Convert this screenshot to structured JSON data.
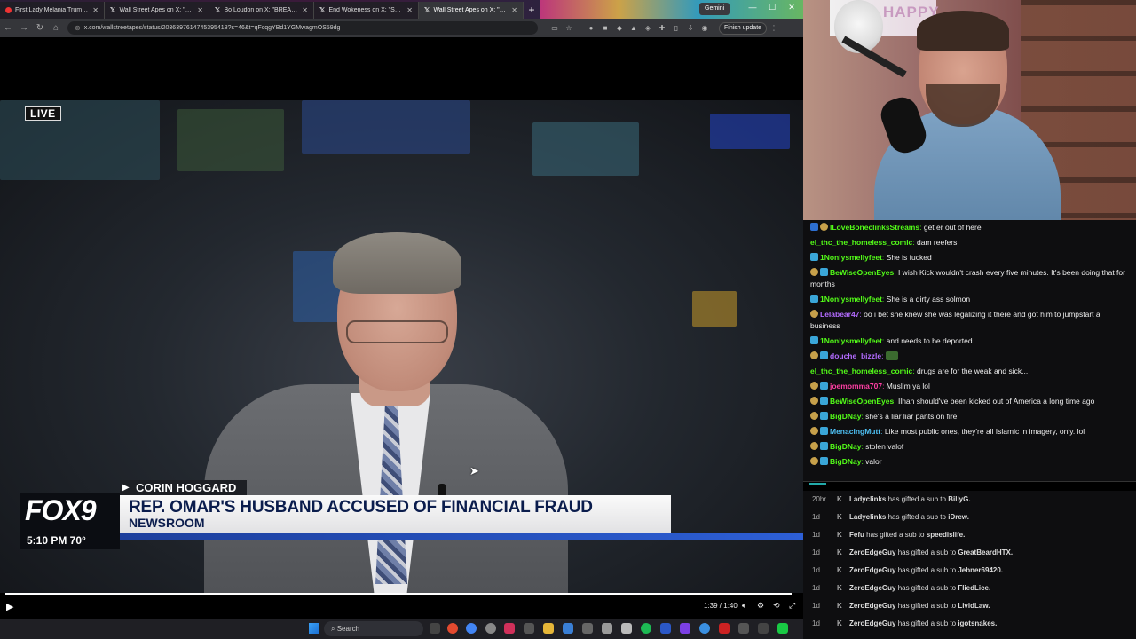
{
  "browser": {
    "tabs": [
      {
        "label": "First Lady Melania Trump Ope…",
        "favicon": "red-dot-icon",
        "active": false
      },
      {
        "label": "Wall Street Apes on X: \"Minne…",
        "favicon": "x-logo-icon",
        "active": false
      },
      {
        "label": "Bo Loudon on X: \"BREA…",
        "favicon": "x-logo-icon",
        "active": false
      },
      {
        "label": "End Wokeness on X: \"Senat…",
        "favicon": "x-logo-icon",
        "active": false
      },
      {
        "label": "Wall Street Apes on X: \"M…",
        "favicon": "x-logo-icon",
        "active": true
      }
    ],
    "new_tab": "+",
    "gemini_label": "Gemini",
    "url": "x.com/wallstreetapes/status/2036397614745395418?s=46&t=qFcqgYBd1YGMwagmOS59dg",
    "finish_update_label": "Finish update"
  },
  "video": {
    "live_label": "LIVE",
    "reporter": "CORIN HOGGARD",
    "headline": "REP. OMAR'S HUSBAND ACCUSED OF FINANCIAL FRAUD",
    "subhead": "NEWSROOM",
    "station_logo": "FOX9",
    "station_time": "5:10 PM   70°",
    "time_display": "1:39 / 1:40",
    "progress": 0.99
  },
  "webcam": {
    "poster_text": "HAPPY"
  },
  "chat": [
    {
      "user": "ILoveBoneclinksStreams",
      "color": "u-green",
      "badges": [
        "tblue",
        "gold"
      ],
      "text": "get er out of here"
    },
    {
      "user": "el_thc_the_homeless_comic",
      "color": "u-green",
      "badges": [],
      "text": "dam reefers"
    },
    {
      "user": "1Nonlysmellyfeet",
      "color": "u-green",
      "badges": [
        "blue"
      ],
      "text": "She is fucked"
    },
    {
      "user": "BeWiseOpenEyes",
      "color": "u-green",
      "badges": [
        "gold",
        "blue"
      ],
      "text": "I wish Kick wouldn't crash every five minutes. It's been doing that for months"
    },
    {
      "user": "1Nonlysmellyfeet",
      "color": "u-green",
      "badges": [
        "blue"
      ],
      "text": "She is a dirty ass solmon"
    },
    {
      "user": "Lelabear47",
      "color": "u-purple",
      "badges": [
        "gold"
      ],
      "text": "oo i bet she knew she was legalizing it there and got him to jumpstart a business"
    },
    {
      "user": "1Nonlysmellyfeet",
      "color": "u-green",
      "badges": [
        "blue"
      ],
      "text": "and needs to be deported"
    },
    {
      "user": "douche_bizzle",
      "color": "u-purple",
      "badges": [
        "gold",
        "blue"
      ],
      "text": "",
      "emote": "pepe-emote"
    },
    {
      "user": "el_thc_the_homeless_comic",
      "color": "u-green",
      "badges": [],
      "text": "drugs are for the weak and sick..."
    },
    {
      "user": "joemomma707",
      "color": "u-pink",
      "badges": [
        "gold",
        "blue"
      ],
      "text": "Muslim ya lol"
    },
    {
      "user": "BeWiseOpenEyes",
      "color": "u-green",
      "badges": [
        "gold",
        "blue"
      ],
      "text": "Ilhan should've been kicked out of America a long time ago"
    },
    {
      "user": "BigDNay",
      "color": "u-green",
      "badges": [
        "gold",
        "blue"
      ],
      "text": "she's a liar liar pants on fire"
    },
    {
      "user": "MenacingMutt",
      "color": "u-lblue",
      "badges": [
        "gold",
        "blue"
      ],
      "text": "Like most public ones, they're all Islamic in imagery, only. lol"
    },
    {
      "user": "BigDNay",
      "color": "u-green",
      "badges": [
        "gold",
        "blue"
      ],
      "text": "stolen valof"
    },
    {
      "user": "BigDNay",
      "color": "u-green",
      "badges": [
        "gold",
        "blue"
      ],
      "text": "valor"
    }
  ],
  "gifts": [
    {
      "age": "20hr",
      "gifter": "Ladyclinks",
      "action": "has gifted a sub to",
      "recipient": "BillyG."
    },
    {
      "age": "1d",
      "gifter": "Ladyclinks",
      "action": "has gifted a sub to",
      "recipient": "iDrew."
    },
    {
      "age": "1d",
      "gifter": "Fefu",
      "action": "has gifted a sub to",
      "recipient": "speedislife."
    },
    {
      "age": "1d",
      "gifter": "ZeroEdgeGuy",
      "action": "has gifted a sub to",
      "recipient": "GreatBeardHTX."
    },
    {
      "age": "1d",
      "gifter": "ZeroEdgeGuy",
      "action": "has gifted a sub to",
      "recipient": "Jebner69420."
    },
    {
      "age": "1d",
      "gifter": "ZeroEdgeGuy",
      "action": "has gifted a sub to",
      "recipient": "FliedLice."
    },
    {
      "age": "1d",
      "gifter": "ZeroEdgeGuy",
      "action": "has gifted a sub to",
      "recipient": "LividLaw."
    },
    {
      "age": "1d",
      "gifter": "ZeroEdgeGuy",
      "action": "has gifted a sub to",
      "recipient": "igotsnakes."
    }
  ],
  "taskbar": {
    "search_placeholder": "Search"
  }
}
